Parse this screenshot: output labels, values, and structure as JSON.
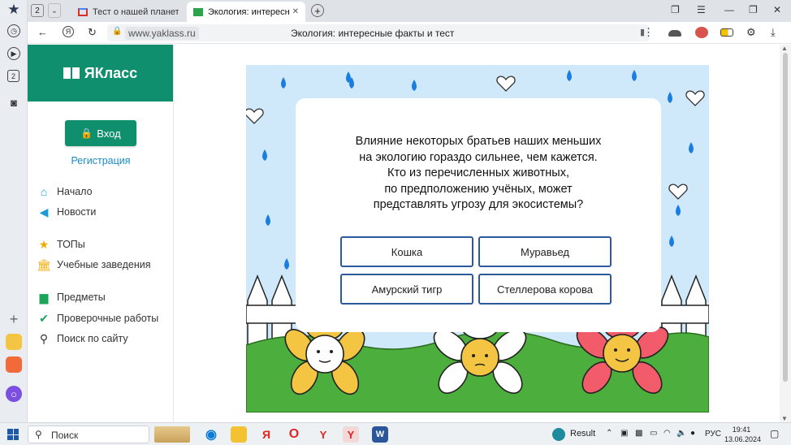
{
  "browser": {
    "tab_count": "2",
    "tabs": [
      {
        "title": "Тест о нашей планете: нес"
      },
      {
        "title": "Экология: интересные ф"
      }
    ],
    "address": {
      "domain": "www.yaklass.ru",
      "page_title": "Экология: интересные факты и тест"
    }
  },
  "site": {
    "logo_text": "ЯКласс",
    "login_label": "Вход",
    "register_link": "Регистрация",
    "menu": [
      {
        "label": "Начало",
        "icon": "home-icon",
        "color": "#1a9ad6"
      },
      {
        "label": "Новости",
        "icon": "megaphone-icon",
        "color": "#1a9ad6"
      },
      {
        "label": "ТОПы",
        "icon": "star-icon",
        "color": "#f2a900"
      },
      {
        "label": "Учебные заведения",
        "icon": "building-icon",
        "color": "#f2a900"
      },
      {
        "label": "Предметы",
        "icon": "book-icon",
        "color": "#1aa55a"
      },
      {
        "label": "Проверочные работы",
        "icon": "check-circle-icon",
        "color": "#1aa55a"
      },
      {
        "label": "Поиск по сайту",
        "icon": "search-icon",
        "color": "#333333"
      }
    ]
  },
  "quiz": {
    "question": "Влияние некоторых братьев наших меньших\nна экологию гораздо сильнее, чем кажется.\nКто из перечисленных животных,\nпо предположению учёных, может\nпредставлять угрозу для экосистемы?",
    "answers": [
      "Кошка",
      "Муравьед",
      "Амурский тигр",
      "Стеллерова корова"
    ]
  },
  "taskbar": {
    "search_label": "Поиск",
    "result_label": "Result",
    "language": "РУС",
    "time": "19:41",
    "date": "13.06.2024"
  },
  "colors": {
    "brand_green": "#0f8f6e",
    "link_blue": "#1a8bc4",
    "answer_border": "#2d5a9e",
    "sky": "#cfe9fa",
    "grass": "#4cae3c"
  }
}
